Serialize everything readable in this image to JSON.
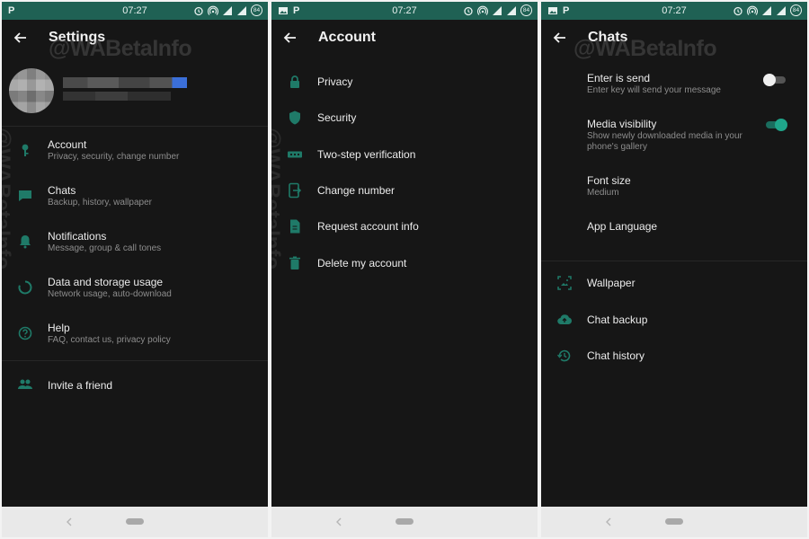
{
  "status_bar": {
    "time": "07:27",
    "battery": "84"
  },
  "watermark": "@WABetaInfo",
  "settings": {
    "title": "Settings",
    "items": [
      {
        "label": "Account",
        "sub": "Privacy, security, change number",
        "icon": "key-icon"
      },
      {
        "label": "Chats",
        "sub": "Backup, history, wallpaper",
        "icon": "chat-icon"
      },
      {
        "label": "Notifications",
        "sub": "Message, group & call tones",
        "icon": "bell-icon"
      },
      {
        "label": "Data and storage usage",
        "sub": "Network usage, auto-download",
        "icon": "data-usage-icon"
      },
      {
        "label": "Help",
        "sub": "FAQ, contact us, privacy policy",
        "icon": "help-icon"
      }
    ],
    "invite": {
      "label": "Invite a friend",
      "icon": "people-icon"
    }
  },
  "account": {
    "title": "Account",
    "items": [
      {
        "label": "Privacy",
        "icon": "lock-icon"
      },
      {
        "label": "Security",
        "icon": "shield-icon"
      },
      {
        "label": "Two-step verification",
        "icon": "dots-icon"
      },
      {
        "label": "Change number",
        "icon": "change-number-icon"
      },
      {
        "label": "Request account info",
        "icon": "document-icon"
      },
      {
        "label": "Delete my account",
        "icon": "trash-icon"
      }
    ]
  },
  "chats": {
    "title": "Chats",
    "settings": [
      {
        "label": "Enter is send",
        "sub": "Enter key will send your message",
        "toggle": false
      },
      {
        "label": "Media visibility",
        "sub": "Show newly downloaded media in your phone's gallery",
        "toggle": true
      },
      {
        "label": "Font size",
        "sub": "Medium"
      },
      {
        "label": "App Language"
      }
    ],
    "items": [
      {
        "label": "Wallpaper",
        "icon": "wallpaper-icon"
      },
      {
        "label": "Chat backup",
        "icon": "cloud-upload-icon"
      },
      {
        "label": "Chat history",
        "icon": "history-icon"
      }
    ]
  },
  "colors": {
    "status_bar": "#1f6154",
    "background": "#161616",
    "icon": "#1f7a68",
    "accent": "#1fa58a"
  }
}
